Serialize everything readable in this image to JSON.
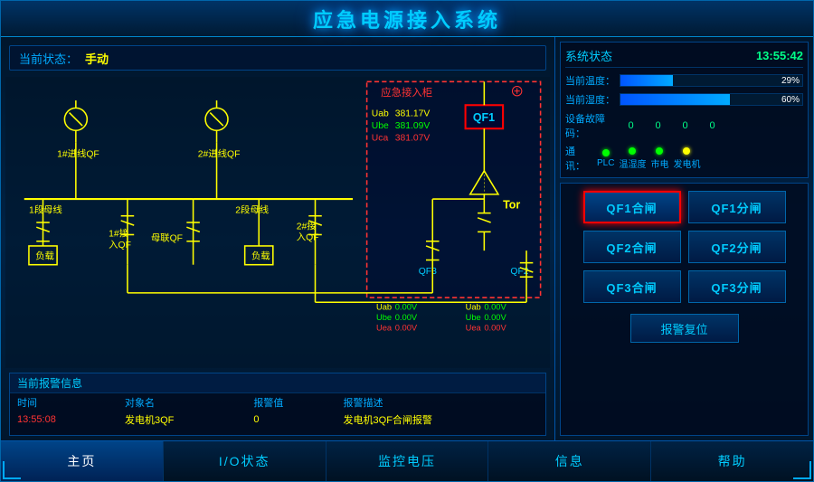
{
  "header": {
    "title": "应急电源接入系统"
  },
  "status_bar": {
    "label": "当前状态：",
    "value": "手动"
  },
  "system_status": {
    "title": "系统状态",
    "time": "13:55:42",
    "temp_label": "当前温度：",
    "temp_value": "29%",
    "temp_percent": 29,
    "humidity_label": "当前湿度：",
    "humidity_value": "60%",
    "humidity_percent": 60,
    "fault_label": "设备故障码：",
    "fault_codes": [
      "0",
      "0",
      "0",
      "0"
    ],
    "comm_label": "通  讯：",
    "comm_items": [
      {
        "name": "PLC",
        "status": "green"
      },
      {
        "name": "温湿度",
        "status": "green"
      },
      {
        "name": "市电",
        "status": "green"
      },
      {
        "name": "发电机",
        "status": "green"
      }
    ]
  },
  "controls": {
    "buttons": [
      {
        "id": "qf1_close",
        "label": "QF1合闸",
        "active": true
      },
      {
        "id": "qf1_open",
        "label": "QF1分闸",
        "active": false
      },
      {
        "id": "qf2_close",
        "label": "QF2合闸",
        "active": false
      },
      {
        "id": "qf2_open",
        "label": "QF2分闸",
        "active": false
      },
      {
        "id": "qf3_close",
        "label": "QF3合闸",
        "active": false
      },
      {
        "id": "qf3_open",
        "label": "QF3分闸",
        "active": false
      }
    ],
    "alarm_reset": "报警复位"
  },
  "alarm": {
    "header": "当前报警信息",
    "columns": [
      "时间",
      "对象名",
      "报警值",
      "报警描述"
    ],
    "rows": [
      {
        "time": "13:55:08",
        "obj": "发电机3QF",
        "val": "0",
        "desc": "发电机3QF合闸报警"
      }
    ]
  },
  "diagram": {
    "emergency_label": "应急接入柜",
    "voltage_readings": [
      {
        "label": "Uab",
        "value": "381.17V",
        "color": "yellow"
      },
      {
        "label": "Ube",
        "value": "381.09V",
        "color": "green"
      },
      {
        "label": "Uca",
        "value": "381.07V",
        "color": "red"
      }
    ],
    "qf1_label": "QF1",
    "qf3_label": "QF3",
    "qf2_label": "QF2",
    "lower_readings_left": [
      {
        "label": "Uab",
        "value": "0.00V"
      },
      {
        "label": "Ube",
        "value": "0.00V"
      },
      {
        "label": "Uea",
        "value": "0.00V"
      }
    ],
    "lower_readings_right": [
      {
        "label": "Uab",
        "value": "0.00V"
      },
      {
        "label": "Ube",
        "value": "0.00V"
      },
      {
        "label": "Uea",
        "value": "0.00V"
      }
    ],
    "labels": {
      "feeder1": "1#进线QF",
      "feeder2": "2#进线QF",
      "bus1": "1段母线",
      "bus2": "2段母线",
      "connect1": "1#接入QF",
      "connect2": "2#接",
      "connect2b": "入QF",
      "buslink": "母联QF",
      "load1": "负载",
      "load2": "负载",
      "tor": "Tor"
    }
  },
  "nav": {
    "items": [
      {
        "label": "主页",
        "active": true
      },
      {
        "label": "I/O状态",
        "active": false
      },
      {
        "label": "监控电压",
        "active": false
      },
      {
        "label": "信息",
        "active": false
      },
      {
        "label": "帮助",
        "active": false
      }
    ]
  }
}
